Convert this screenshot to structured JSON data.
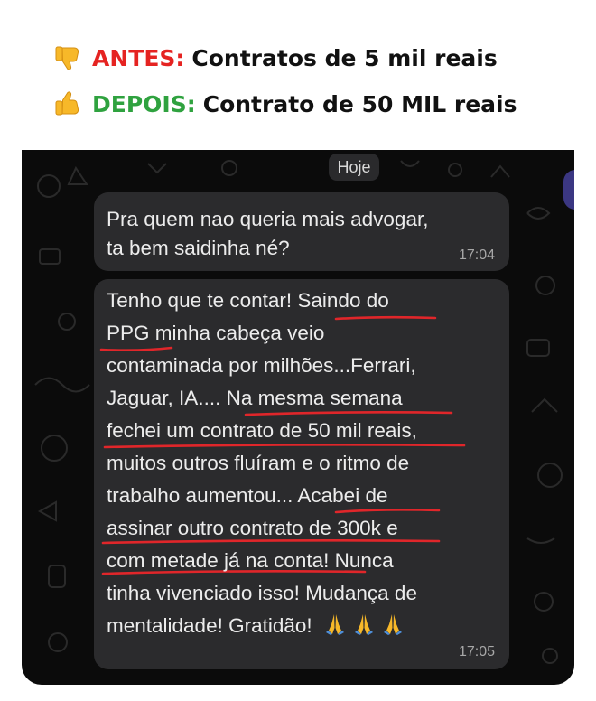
{
  "header": {
    "before_tag": "ANTES:",
    "before_text": "Contratos de 5 mil reais",
    "after_tag": "DEPOIS:",
    "after_text": "Contrato de 50 MIL reais",
    "before_icon": "thumbs-down-icon",
    "after_icon": "thumbs-up-icon",
    "colors": {
      "before_tag": "#e52321",
      "after_tag": "#2fa23f",
      "emoji": "#f7b829"
    }
  },
  "chat": {
    "date_label": "Hoje",
    "messages": [
      {
        "lines": [
          "Pra quem nao queria mais advogar,",
          "ta bem saidinha né?"
        ],
        "time": "17:04"
      },
      {
        "lines": [
          "Tenho que te contar! Saindo do",
          "PPG minha cabeça veio",
          "contaminada por milhões...Ferrari,",
          "Jaguar, IA.... Na mesma semana",
          "fechei um contrato de 50 mil reais,",
          "muitos outros fluíram e o ritmo de",
          "trabalho aumentou... Acabei de",
          "assinar outro contrato de 300k e",
          "com metade já na conta! Nunca",
          "tinha vivenciado isso! Mudança de",
          "mentalidade! Gratidão!"
        ],
        "trailing_icons": [
          "folded-hands-icon",
          "folded-hands-icon",
          "folded-hands-icon"
        ],
        "time": "17:05",
        "highlight_color": "#e0262a"
      }
    ],
    "colors": {
      "background": "#0b0b0b",
      "bubble": "#2b2b2d",
      "text": "#ececec",
      "timestamp": "#a7a7a7"
    }
  }
}
